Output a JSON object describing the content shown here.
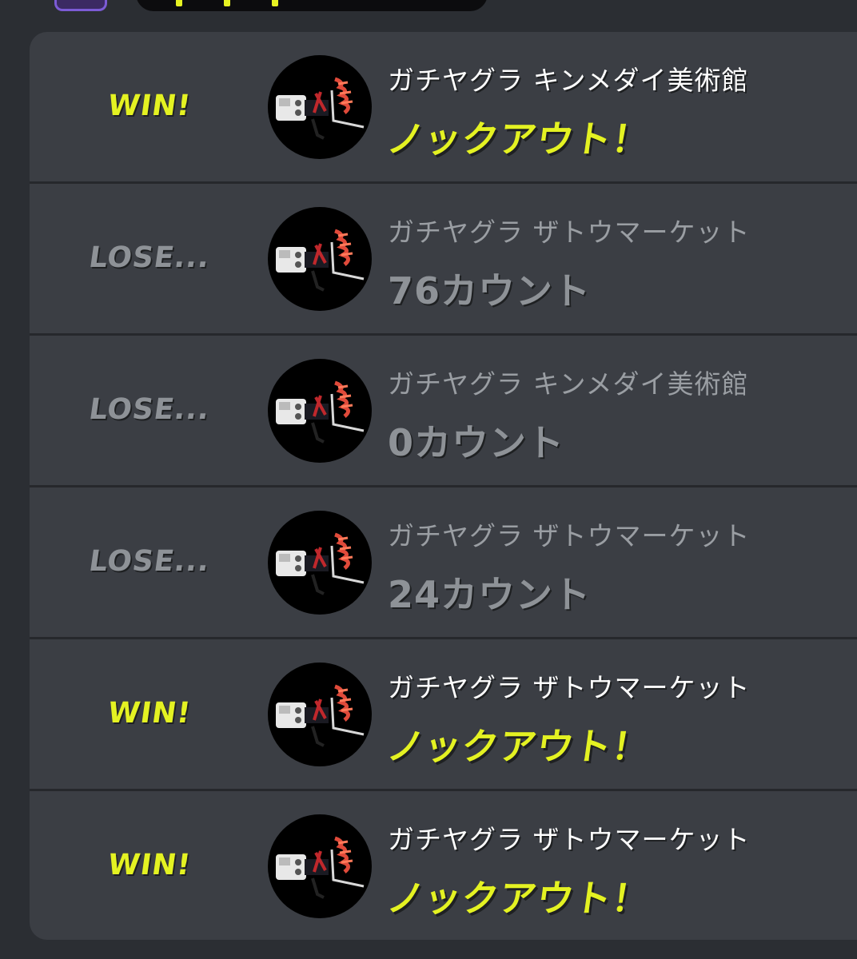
{
  "colors": {
    "win": "#e4f222",
    "lose": "#8e9297",
    "card_bg": "#3b3e44",
    "page_bg": "#2b2e33"
  },
  "battles": [
    {
      "result": "WIN!",
      "outcome": "win",
      "stage": "ガチヤグラ キンメダイ美術館",
      "score": "ノックアウト！"
    },
    {
      "result": "LOSE...",
      "outcome": "lose",
      "stage": "ガチヤグラ ザトウマーケット",
      "score": "76カウント"
    },
    {
      "result": "LOSE...",
      "outcome": "lose",
      "stage": "ガチヤグラ キンメダイ美術館",
      "score": "0カウント"
    },
    {
      "result": "LOSE...",
      "outcome": "lose",
      "stage": "ガチヤグラ ザトウマーケット",
      "score": "24カウント"
    },
    {
      "result": "WIN!",
      "outcome": "win",
      "stage": "ガチヤグラ ザトウマーケット",
      "score": "ノックアウト！"
    },
    {
      "result": "WIN!",
      "outcome": "win",
      "stage": "ガチヤグラ ザトウマーケット",
      "score": "ノックアウト！"
    }
  ],
  "weapon_icon": "weapon-icon"
}
